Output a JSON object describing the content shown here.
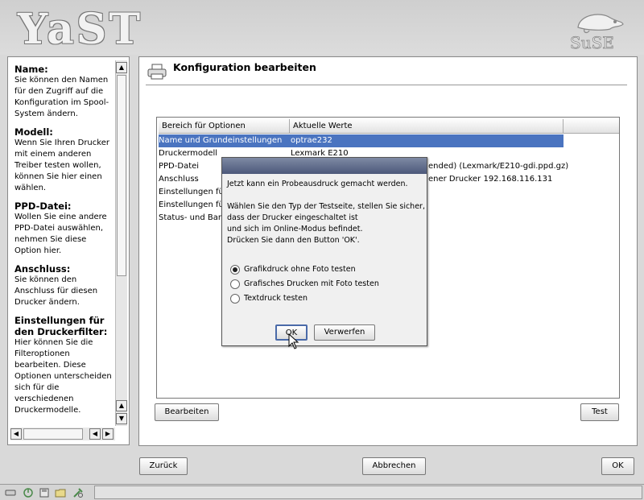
{
  "header": {
    "yast_logo": "YaST",
    "suse_logo": "SuSE"
  },
  "help": {
    "sections": [
      {
        "heading": "Name:",
        "text": "Sie können den Namen für den Zugriff auf die Konfiguration im Spool-System ändern."
      },
      {
        "heading": "Modell:",
        "text": "Wenn Sie Ihren Drucker mit einem anderen Treiber testen wollen, können Sie hier einen wählen."
      },
      {
        "heading": "PPD-Datei:",
        "text": "Wollen Sie eine andere PPD-Datei auswählen, nehmen Sie diese Option hier."
      },
      {
        "heading": "Anschluss:",
        "text": "Sie können den Anschluss für diesen Drucker ändern."
      },
      {
        "heading": "Einstellungen für den Druckerfilter:",
        "text": "Hier können Sie die Filteroptionen bearbeiten. Diese Optionen unterscheiden sich für die verschiedenen Druckermodelle."
      }
    ]
  },
  "main": {
    "title": "Konfiguration bearbeiten",
    "table": {
      "columns": [
        "Bereich für Optionen",
        "Aktuelle Werte"
      ],
      "rows": [
        {
          "option": "Name und Grundeinstellungen",
          "value": "optrae232"
        },
        {
          "option": "Druckermodell",
          "value": "Lexmark  E210"
        },
        {
          "option": "PPD-Datei",
          "value": "ended) (Lexmark/E210-gdi.ppd.gz)"
        },
        {
          "option": "Anschluss",
          "value": "ener Drucker 192.168.116.131"
        },
        {
          "option": "Einstellungen für",
          "value": ""
        },
        {
          "option": "Einstellungen für",
          "value": ""
        },
        {
          "option": "Status- und Ban",
          "value": ""
        }
      ]
    },
    "edit_button": "Bearbeiten",
    "test_button": "Test"
  },
  "dialog": {
    "line1": "Jetzt kann ein Probeausdruck gemacht werden.",
    "line2": "Wählen Sie den Typ der Testseite, stellen Sie sicher,",
    "line3": "dass der Drucker eingeschaltet ist",
    "line4": "und sich im Online-Modus befindet.",
    "line5": "Drücken Sie dann den Button 'OK'.",
    "options": [
      {
        "label": "Grafikdruck ohne Foto testen",
        "selected": true
      },
      {
        "label": "Grafisches Drucken mit Foto testen",
        "selected": false
      },
      {
        "label": "Textdruck testen",
        "selected": false
      }
    ],
    "ok": "OK",
    "discard": "Verwerfen"
  },
  "footer": {
    "back": "Zurück",
    "abort": "Abbrechen",
    "ok": "OK"
  },
  "colors": {
    "selection": "#4a74c0",
    "titlebar": "#5c6888"
  }
}
